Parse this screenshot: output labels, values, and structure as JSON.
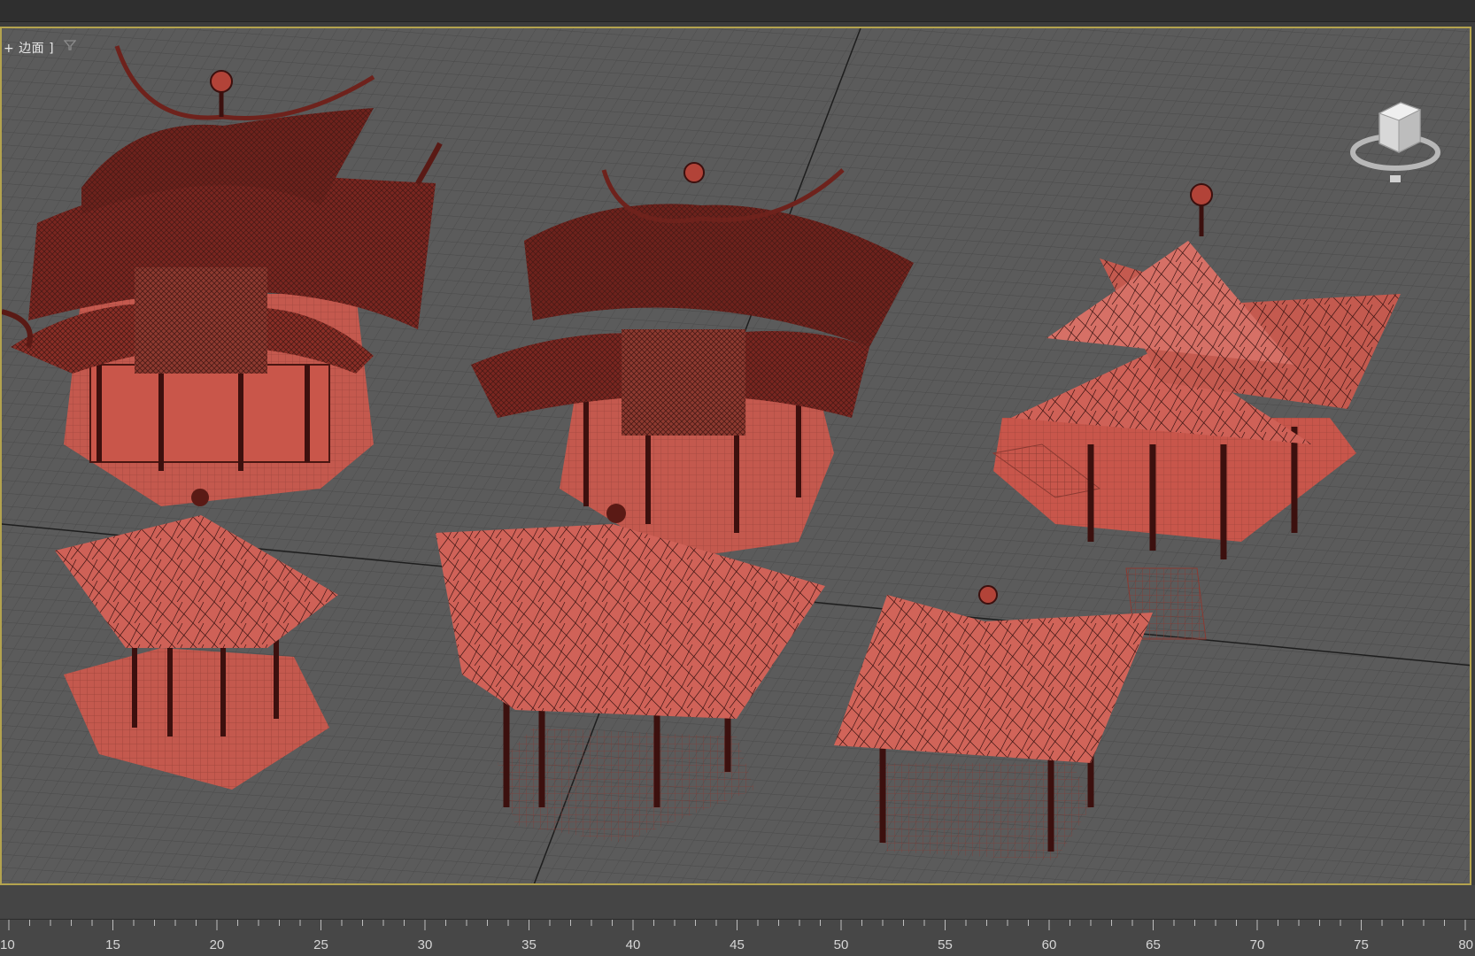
{
  "viewport": {
    "label": "+ 边面 ]",
    "filter_icon": "filter-icon",
    "viewcube_icon": "viewcube-icon",
    "border_color": "#b4a34e",
    "model_color": "#c8544a"
  },
  "timeline": {
    "ticks": [
      "10",
      "15",
      "20",
      "25",
      "30",
      "35",
      "40",
      "45",
      "50",
      "55",
      "60",
      "65",
      "70",
      "75",
      "80"
    ]
  }
}
